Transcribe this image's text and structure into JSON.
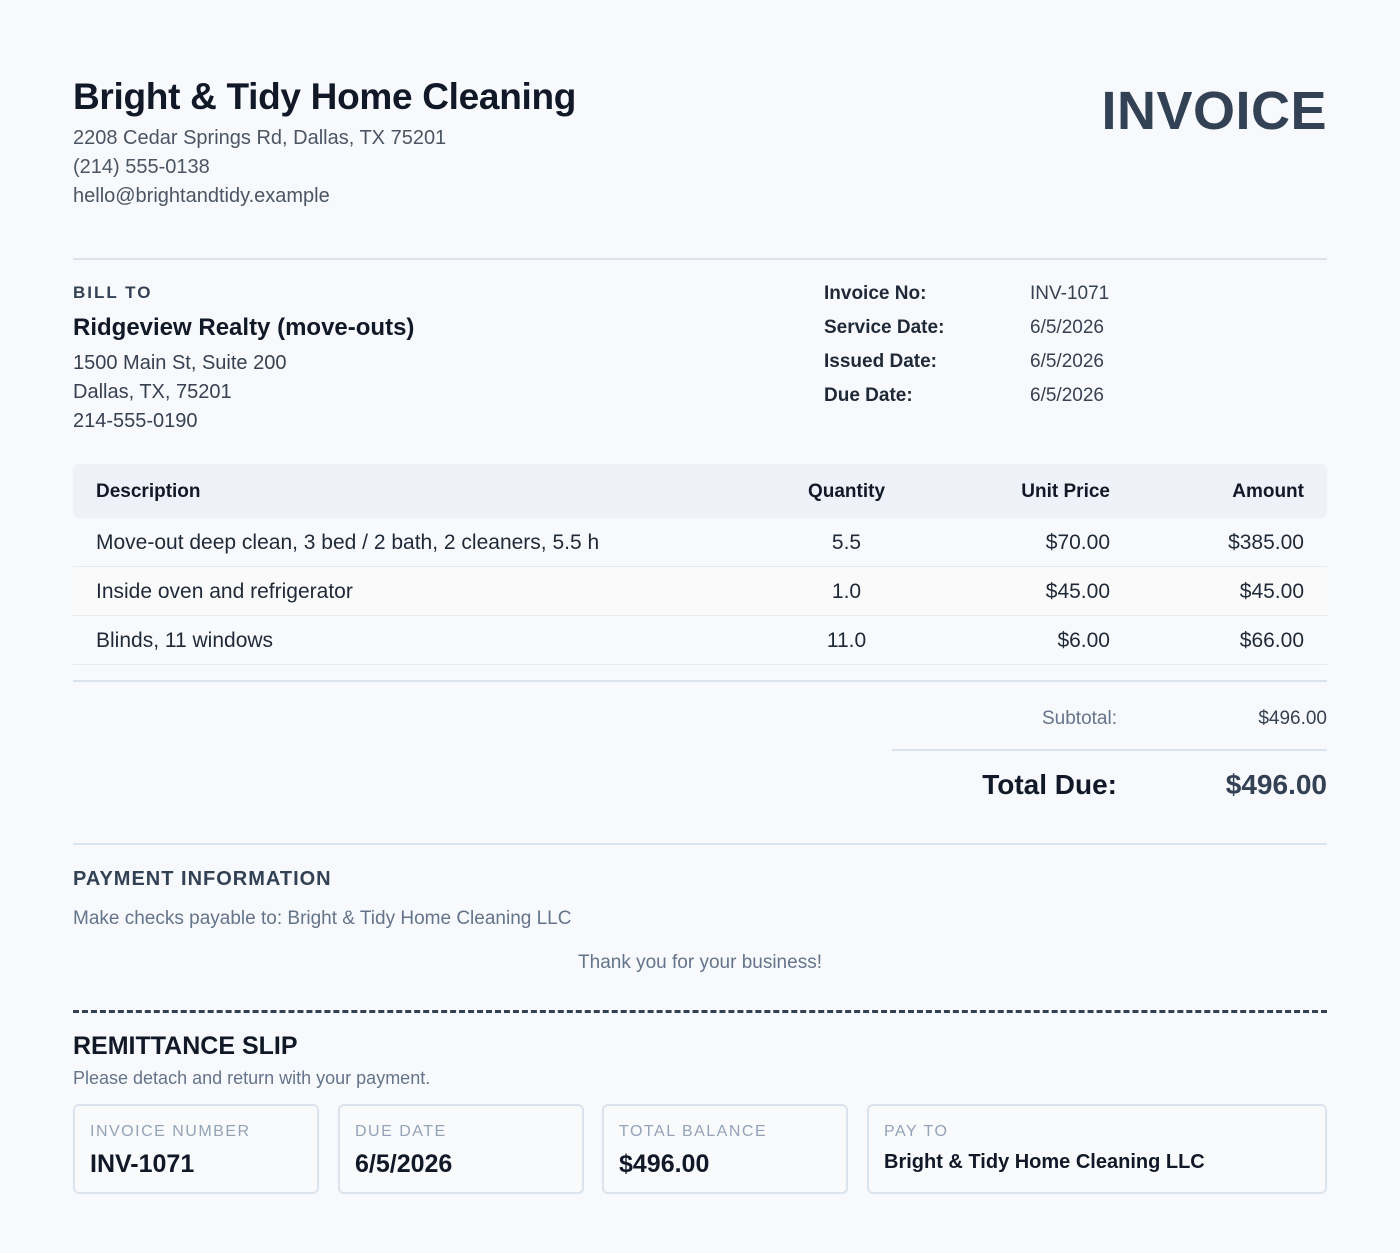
{
  "company": {
    "name": "Bright & Tidy Home Cleaning",
    "address": "2208 Cedar Springs Rd, Dallas, TX 75201",
    "phone": "(214) 555-0138",
    "email": "hello@brightandtidy.example"
  },
  "document_title": "INVOICE",
  "bill_to": {
    "label": "BILL TO",
    "name": "Ridgeview Realty (move-outs)",
    "address_line1": "1500 Main St, Suite 200",
    "address_line2": "Dallas, TX, 75201",
    "phone": "214-555-0190"
  },
  "meta": [
    {
      "label": "Invoice No:",
      "value": "INV-1071"
    },
    {
      "label": "Service Date:",
      "value": "6/5/2026"
    },
    {
      "label": "Issued Date:",
      "value": "6/5/2026"
    },
    {
      "label": "Due Date:",
      "value": "6/5/2026"
    }
  ],
  "table": {
    "headers": {
      "description": "Description",
      "quantity": "Quantity",
      "unit_price": "Unit Price",
      "amount": "Amount"
    },
    "rows": [
      {
        "description": "Move-out deep clean, 3 bed / 2 bath, 2 cleaners, 5.5 h",
        "quantity": "5.5",
        "unit_price": "$70.00",
        "amount": "$385.00"
      },
      {
        "description": "Inside oven and refrigerator",
        "quantity": "1.0",
        "unit_price": "$45.00",
        "amount": "$45.00"
      },
      {
        "description": "Blinds, 11 windows",
        "quantity": "11.0",
        "unit_price": "$6.00",
        "amount": "$66.00"
      }
    ]
  },
  "totals": {
    "subtotal_label": "Subtotal:",
    "subtotal_value": "$496.00",
    "total_label": "Total Due:",
    "total_value": "$496.00"
  },
  "payment": {
    "title": "PAYMENT INFORMATION",
    "text": "Make checks payable to: Bright & Tidy Home Cleaning LLC",
    "thanks": "Thank you for your business!"
  },
  "remittance": {
    "title": "REMITTANCE SLIP",
    "subtitle": "Please detach and return with your payment.",
    "boxes": [
      {
        "label": "INVOICE NUMBER",
        "value": "INV-1071"
      },
      {
        "label": "DUE DATE",
        "value": "6/5/2026"
      },
      {
        "label": "TOTAL BALANCE",
        "value": "$496.00"
      },
      {
        "label": "PAY TO",
        "value": "Bright & Tidy Home Cleaning LLC"
      }
    ]
  }
}
